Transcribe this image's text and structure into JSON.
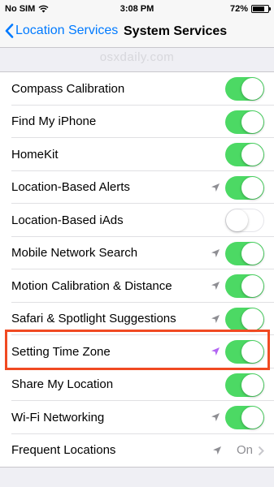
{
  "status": {
    "carrier": "No SIM",
    "time": "3:08 PM",
    "battery": "72%"
  },
  "nav": {
    "back_label": "Location Services",
    "title": "System Services"
  },
  "watermark": "osxdaily.com",
  "colors": {
    "accent": "#007aff",
    "switch_on": "#4cd964",
    "highlight": "#f04a22",
    "active_location_arrow": "#b265f2"
  },
  "rows": [
    {
      "label": "Compass Calibration",
      "toggle": "on",
      "arrow": null
    },
    {
      "label": "Find My iPhone",
      "toggle": "on",
      "arrow": null
    },
    {
      "label": "HomeKit",
      "toggle": "on",
      "arrow": null
    },
    {
      "label": "Location-Based Alerts",
      "toggle": "on",
      "arrow": "gray"
    },
    {
      "label": "Location-Based iAds",
      "toggle": "off",
      "arrow": null
    },
    {
      "label": "Mobile Network Search",
      "toggle": "on",
      "arrow": "gray"
    },
    {
      "label": "Motion Calibration & Distance",
      "toggle": "on",
      "arrow": "gray"
    },
    {
      "label": "Safari & Spotlight Suggestions",
      "toggle": "on",
      "arrow": "gray"
    },
    {
      "label": "Setting Time Zone",
      "toggle": "on",
      "arrow": "purple"
    },
    {
      "label": "Share My Location",
      "toggle": "on",
      "arrow": null
    },
    {
      "label": "Wi-Fi Networking",
      "toggle": "on",
      "arrow": "gray"
    },
    {
      "label": "Frequent Locations",
      "value": "On",
      "arrow": "gray"
    }
  ]
}
